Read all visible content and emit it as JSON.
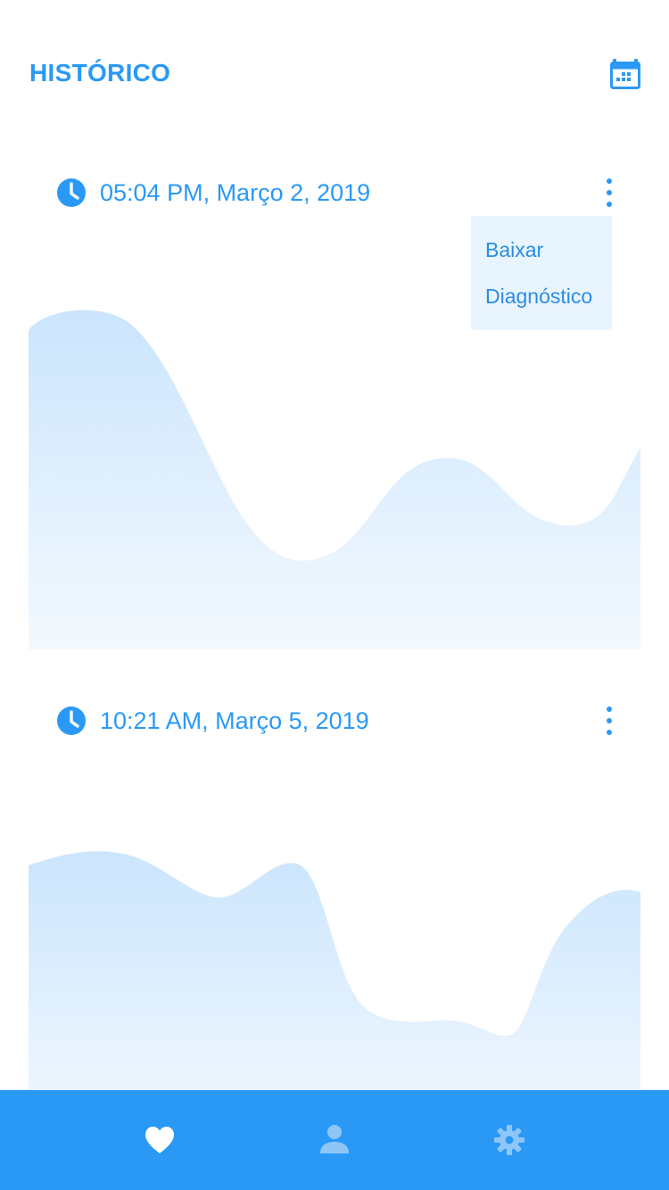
{
  "header": {
    "title": "HISTÓRICO",
    "calendar_icon": "calendar-icon"
  },
  "records": [
    {
      "time_label": "05:04 PM, Março 2, 2019",
      "icon": "clock-icon",
      "menu_icon": "more-vertical-icon"
    },
    {
      "time_label": "10:21 AM, Março 5, 2019",
      "icon": "clock-icon",
      "menu_icon": "more-vertical-icon"
    }
  ],
  "dropdown": {
    "items": [
      "Baixar",
      "Diagnóstico"
    ]
  },
  "bottom_nav": {
    "items": [
      {
        "icon": "heart-icon",
        "active": true
      },
      {
        "icon": "user-icon",
        "active": false
      },
      {
        "icon": "gear-icon",
        "active": false
      }
    ]
  },
  "colors": {
    "accent": "#2a99f5",
    "dropdown_bg": "#e8f4fe",
    "wave_top": "#cbe5fd",
    "wave_bottom": "#f3f9fe",
    "nav_inactive_icon": "#8ec6f7"
  }
}
